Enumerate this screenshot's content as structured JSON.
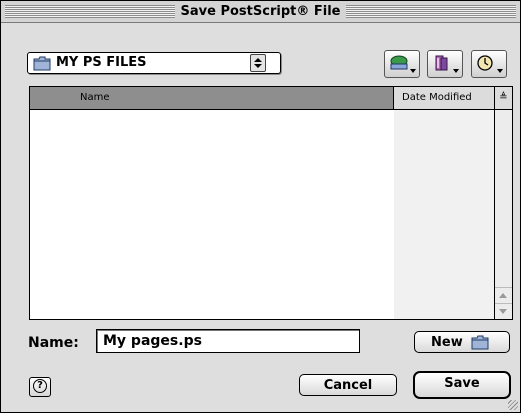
{
  "window": {
    "title": "Save PostScript® File"
  },
  "folder_popup": {
    "label": "MY PS FILES",
    "icon": "folder-icon"
  },
  "toolbar": {
    "buttons": [
      {
        "icon": "volume-icon"
      },
      {
        "icon": "favorites-icon"
      },
      {
        "icon": "recent-clock-icon"
      }
    ]
  },
  "file_list": {
    "columns": [
      "Name",
      "Date Modified"
    ],
    "sort_indicator": "≜",
    "rows": []
  },
  "name_field": {
    "label": "Name:",
    "value": "My pages.ps"
  },
  "buttons": {
    "new": "New",
    "cancel": "Cancel",
    "save": "Save",
    "help": "?"
  }
}
